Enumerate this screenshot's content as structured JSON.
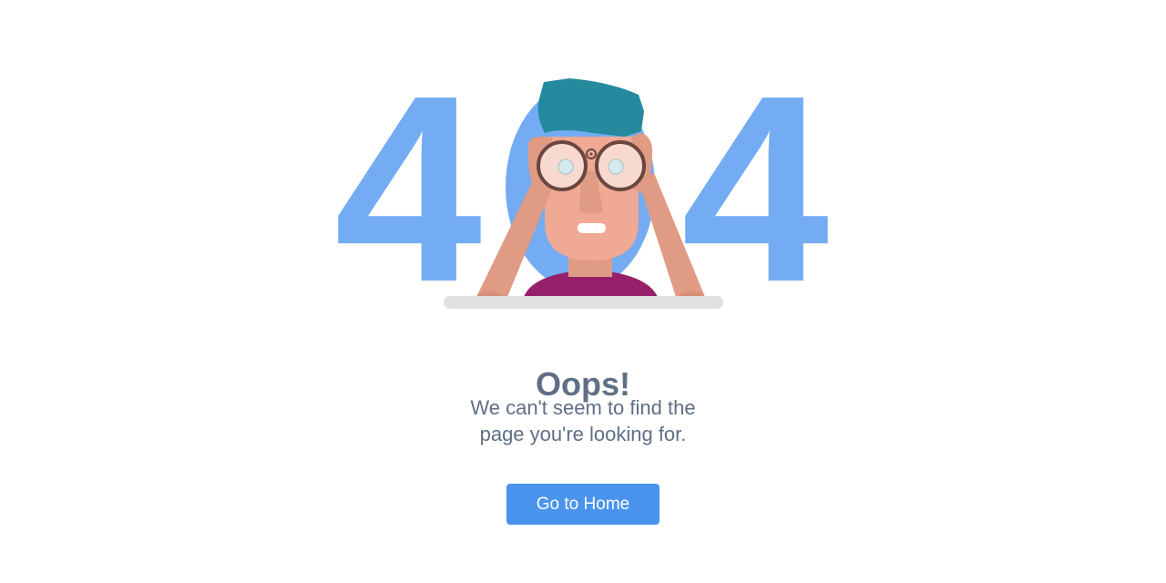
{
  "hero": {
    "digit_left": "4",
    "digit_right": "4",
    "digit_color": "#73acf2"
  },
  "content": {
    "title": "Oops!",
    "message_line1": "We can't seem to find the",
    "message_line2": "page you're looking for."
  },
  "actions": {
    "home_label": "Go to Home"
  },
  "colors": {
    "text": "#5f6f85",
    "button": "#4a94ee",
    "hair": "#268a9e",
    "skin": "#efa994",
    "arm": "#e09b84",
    "shirt": "#96216a",
    "glasses_frame": "#6b4640",
    "shelf": "#e0e0e0"
  }
}
